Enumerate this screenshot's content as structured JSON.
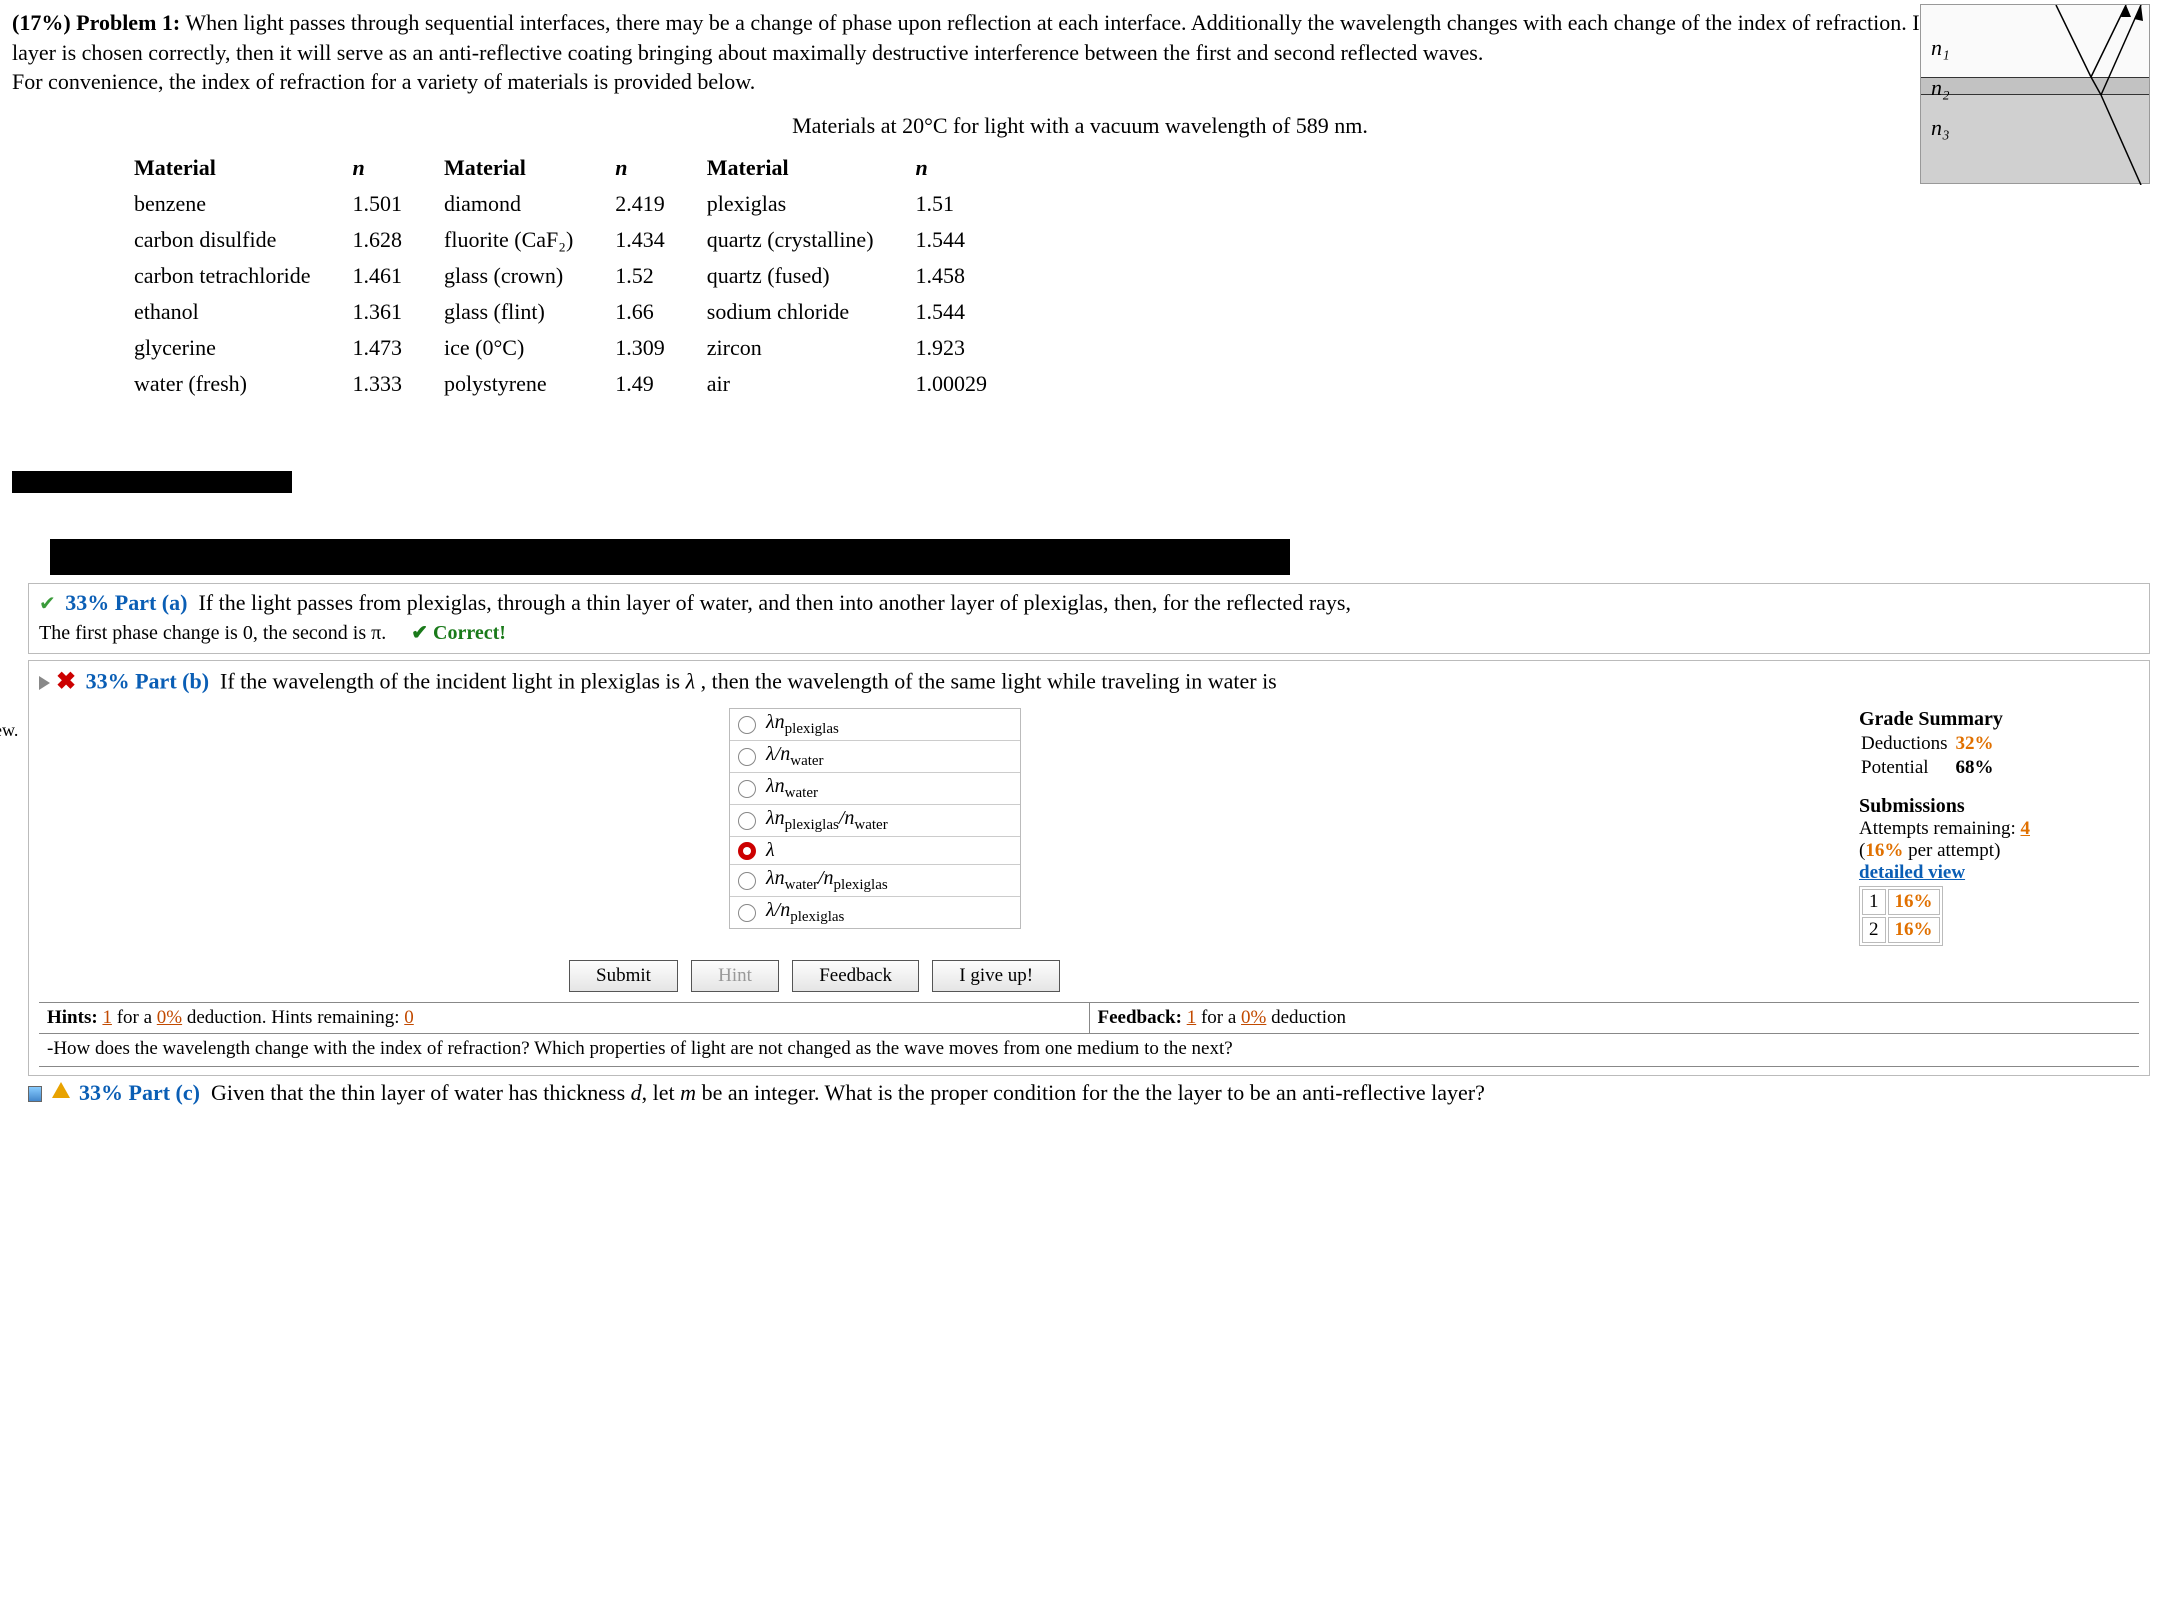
{
  "problem": {
    "weight": "(17%)",
    "label": "Problem 1:",
    "text": "When light passes through sequential interfaces, there may be a change of phase upon reflection at each interface. Additionally the wavelength changes with each change of the index of refraction. If the thickness of a thin layer is chosen correctly, then it will serve as an anti-reflective coating bringing about maximally destructive interference between the first and second reflected waves.",
    "convenience": "For convenience, the index of refraction for a variety of materials is provided below."
  },
  "diagram": {
    "n1": "n₁",
    "n2": "n₂",
    "n3": "n₃"
  },
  "table": {
    "caption": "Materials at 20°C for light with a vacuum wavelength of 589 nm.",
    "head_material": "Material",
    "head_n": "n",
    "cols": [
      [
        {
          "m": "benzene",
          "n": "1.501"
        },
        {
          "m": "carbon disulfide",
          "n": "1.628"
        },
        {
          "m": "carbon tetrachloride",
          "n": "1.461"
        },
        {
          "m": "ethanol",
          "n": "1.361"
        },
        {
          "m": "glycerine",
          "n": "1.473"
        },
        {
          "m": "water (fresh)",
          "n": "1.333"
        }
      ],
      [
        {
          "m": "diamond",
          "n": "2.419"
        },
        {
          "m": "fluorite (CaF₂)",
          "n": "1.434"
        },
        {
          "m": "glass (crown)",
          "n": "1.52"
        },
        {
          "m": "glass (flint)",
          "n": "1.66"
        },
        {
          "m": "ice (0°C)",
          "n": "1.309"
        },
        {
          "m": "polystyrene",
          "n": "1.49"
        }
      ],
      [
        {
          "m": "plexiglas",
          "n": "1.51"
        },
        {
          "m": "quartz (crystalline)",
          "n": "1.544"
        },
        {
          "m": "quartz (fused)",
          "n": "1.458"
        },
        {
          "m": "sodium chloride",
          "n": "1.544"
        },
        {
          "m": "zircon",
          "n": "1.923"
        },
        {
          "m": "air",
          "n": "1.00029"
        }
      ]
    ]
  },
  "ew": "ew.",
  "partA": {
    "pct": "33%",
    "label": "Part (a)",
    "prompt": "If the light passes from plexiglas, through a thin layer of water, and then into another layer of plexiglas, then, for the reflected rays,",
    "answer": "The first phase change is 0, the second is π.",
    "feedback": "Correct!"
  },
  "partB": {
    "pct": "33%",
    "label": "Part (b)",
    "prompt": "If the wavelength of the incident light in plexiglas is λ , then the wavelength of the same light while traveling in water is",
    "choices": [
      "λnₚₗₑₓᵢgₗₐₛ",
      "λ/nᵥᵥₐₜₑᵣ",
      "λnᵥᵥₐₜₑᵣ",
      "λnₚₗₑₓᵢgₗₐₛ/nᵥᵥₐₜₑᵣ",
      "λ",
      "λnᵥᵥₐₜₑᵣ/nₚₗₑₓᵢgₗₐₛ",
      "λ/nₚₗₑₓᵢgₗₐₛ"
    ],
    "selected": 4,
    "buttons": {
      "submit": "Submit",
      "hint": "Hint",
      "feedback": "Feedback",
      "giveup": "I give up!"
    }
  },
  "grade": {
    "title": "Grade Summary",
    "ded_lbl": "Deductions",
    "ded_val": "32%",
    "pot_lbl": "Potential",
    "pot_val": "68%",
    "sub_title": "Submissions",
    "attempts_lbl": "Attempts remaining:",
    "attempts_val": "4",
    "per": "(16% per attempt)",
    "detailed": "detailed view",
    "rows": [
      {
        "n": "1",
        "p": "16%"
      },
      {
        "n": "2",
        "p": "16%"
      }
    ]
  },
  "hints": {
    "title": "Hints:",
    "cnt": "1",
    "for": "for a",
    "pct": "0%",
    "ded": "deduction. Hints remaining:",
    "rem": "0",
    "text": "-How does the wavelength change with the index of refraction? Which properties of light are not changed as the wave moves from one medium to the next?"
  },
  "feedback": {
    "title": "Feedback:",
    "cnt": "1",
    "for": "for a",
    "pct": "0%",
    "ded": "deduction"
  },
  "partC": {
    "pct": "33%",
    "label": "Part (c)",
    "prompt": "Given that the thin layer of water has thickness d, let m be an integer. What is the proper condition for the the layer to be an anti-reflective layer?"
  }
}
